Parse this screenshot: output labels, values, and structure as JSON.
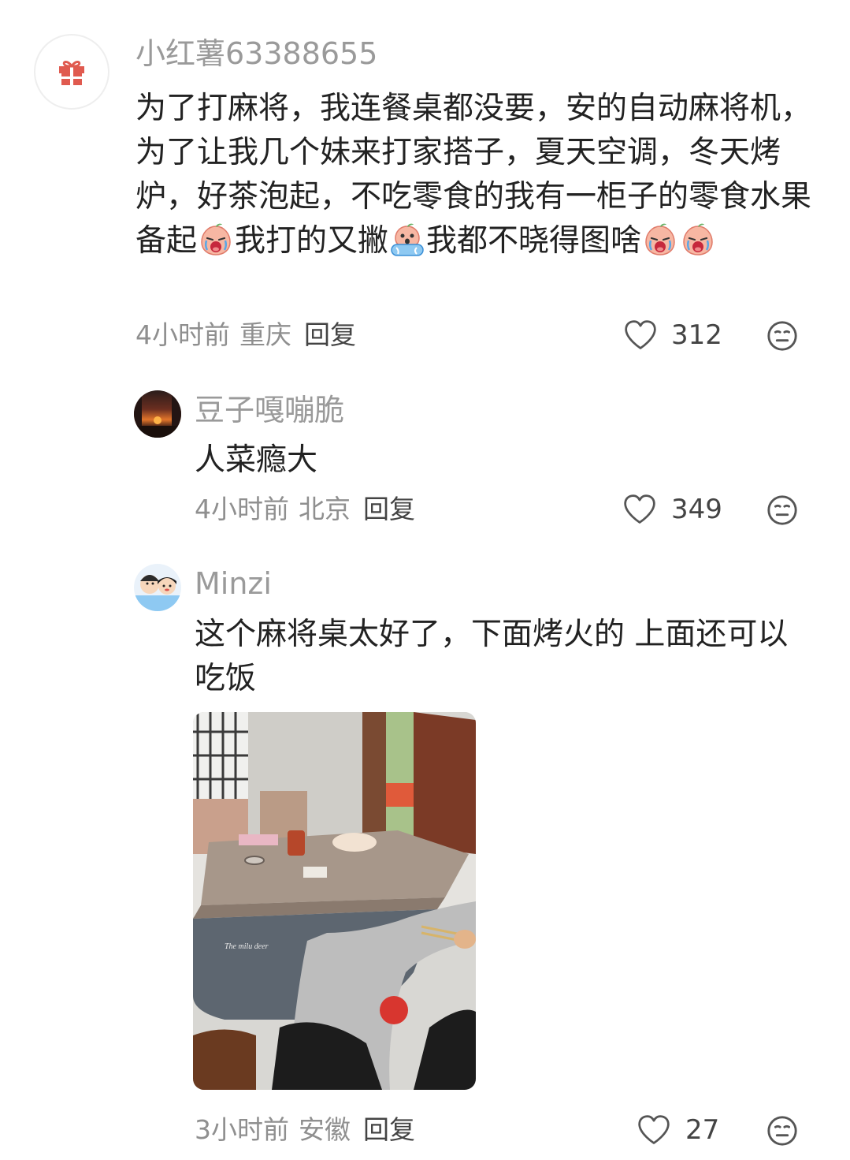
{
  "comments": [
    {
      "username": "小红薯63388655",
      "text_parts": [
        "为了打麻将，我连餐桌都没要，安的自动麻将机，为了让我几个妹来打家搭子，夏天空调，冬天烤炉，好茶泡起，不吃零食的我有一柜子的零食水果备起",
        "我打的又撇",
        "我都不晓得图啥"
      ],
      "time": "4小时前",
      "location": "重庆",
      "reply_label": "回复",
      "likes": "312"
    },
    {
      "username": "豆子嘎嘣脆",
      "text": "人菜瘾大",
      "time": "4小时前",
      "location": "北京",
      "reply_label": "回复",
      "likes": "349"
    },
    {
      "username": "Minzi",
      "text": "这个麻将桌太好了，下面烤火的 上面还可以吃饭",
      "time": "3小时前",
      "location": "安徽",
      "reply_label": "回复",
      "likes": "27",
      "photo_text": "The milu deer"
    }
  ],
  "icons": {
    "avatar_main": "gift-icon",
    "like": "heart-outline-icon",
    "reaction": "neutral-face-icon",
    "emoji_crying": "crying-peach-emoji",
    "emoji_scared": "scared-peach-emoji"
  },
  "colors": {
    "username": "#9a9a9a",
    "text": "#222222",
    "meta": "#8f8f8f",
    "gift": "#e05a4f"
  }
}
